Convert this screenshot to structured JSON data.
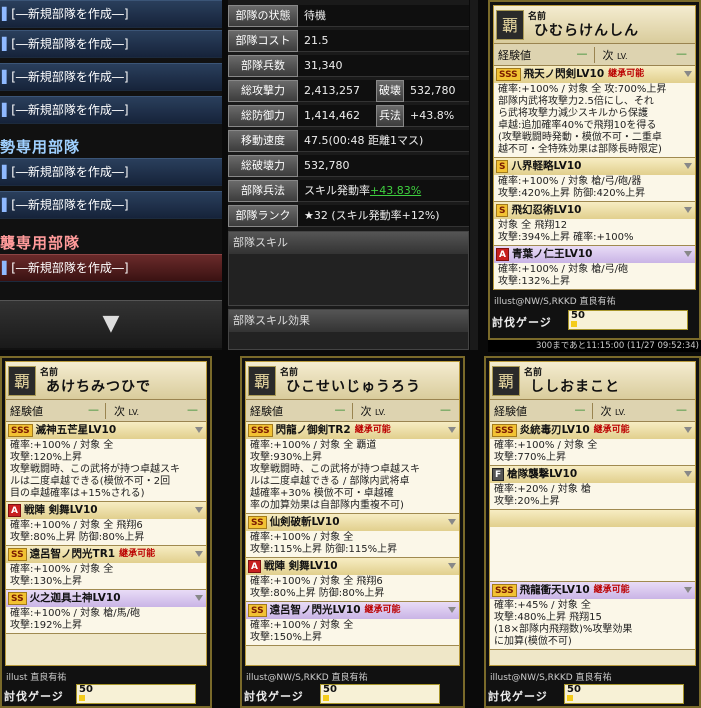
{
  "left": {
    "slots": [
      "[―新規部隊を作成―]",
      "[―新規部隊を作成―]",
      "[―新規部隊を作成―]",
      "[―新規部隊を作成―]",
      "[―新規部隊を作成―]",
      "[―新規部隊を作成―]",
      "[―新規部隊を作成―]"
    ],
    "sec1": "勢専用部隊",
    "sec2": "襲専用部隊",
    "arrow": "▼"
  },
  "stats": {
    "status_l": "部隊の状態",
    "status_v": "待機",
    "cost_l": "部隊コスト",
    "cost_v": "21.5",
    "troops_l": "部隊兵数",
    "troops_v": "31,340",
    "atk_l": "総攻撃力",
    "atk_v": "2,413,257",
    "break_l": "破壊",
    "break_v": "532,780",
    "def_l": "総防御力",
    "def_v": "1,414,462",
    "hei_l": "兵法",
    "hei_v": "+43.8%",
    "speed_l": "移動速度",
    "speed_v": "47.5(00:48 距離1マス)",
    "totbreak_l": "総破壊力",
    "totbreak_v": "532,780",
    "heiho_l": "部隊兵法",
    "heiho_v": "スキル発動率",
    "heiho_g": "+43.83%",
    "rank_l": "部隊ランク",
    "rank_v": "★32 (スキル発動率+12%)",
    "skill_h": "部隊スキル",
    "effect_h": "部隊スキル効果"
  },
  "cards": [
    {
      "label": "名前",
      "name": "ひむらけんしん",
      "exp_l": "経験値",
      "exp_v": "—",
      "next_l": "次",
      "next_lv": "LV.",
      "next_v": "—",
      "skills": [
        {
          "rank": "SSS",
          "name": "飛天ノ閃剣LV10",
          "tag": "継承可能",
          "desc": [
            "確率:+100% / 対象 全 攻:700%上昇",
            "部隊内武将攻撃力2.5倍にし、それ",
            "ら武将攻撃力減少スキルから保護",
            "卓越:追加確率40%で飛翔10を得る",
            "(攻撃戦闘時発動・模倣不可・二重卓",
            "越不可・全特殊効果は部隊長時限定)"
          ]
        },
        {
          "rank": "S",
          "name": "八界軽略LV10",
          "desc": [
            "確率:+100% / 対象 槍/弓/砲/器",
            "攻撃:420%上昇 防御:420%上昇"
          ]
        },
        {
          "rank": "S",
          "name": "飛幻忍術LV10",
          "desc": [
            "対象 全 飛翔12",
            "攻撃:394%上昇 確率:+100%"
          ]
        },
        {
          "rank": "A",
          "name": "青葉ノ仁王LV10",
          "purple": true,
          "desc": [
            "確率:+100% / 対象 槍/弓/砲",
            "攻撃:132%上昇"
          ]
        }
      ],
      "illust": "illust@NW/S,RKKD 直良有祐",
      "gauge_l": "討伐ゲージ",
      "gauge_v": "50"
    },
    {
      "label": "名前",
      "name": "あけちみつひで",
      "exp_l": "経験値",
      "exp_v": "—",
      "next_l": "次",
      "next_lv": "LV.",
      "next_v": "—",
      "skills": [
        {
          "rank": "SSS",
          "name": "滅神五芒星LV10",
          "desc": [
            "確率:+100% / 対象 全",
            "攻撃:120%上昇",
            "攻撃戦闘時、この武将が持つ卓越スキ",
            "ルは二度卓越できる(模倣不可・2回",
            "目の卓越確率は+15%される)"
          ]
        },
        {
          "rank": "A",
          "name": "戦陣 剣舞LV10",
          "desc": [
            "確率:+100% / 対象 全 飛翔6",
            "攻撃:80%上昇 防御:80%上昇"
          ]
        },
        {
          "rank": "SS",
          "name": "遠呂智ノ閃光TR1",
          "tag": "継承可能",
          "desc": [
            "確率:+100% / 対象 全",
            "攻撃:130%上昇"
          ]
        },
        {
          "rank": "SS",
          "name": "火之迦具土神LV10",
          "purple": true,
          "desc": [
            "確率:+100% / 対象 槍/馬/砲",
            "攻撃:192%上昇"
          ]
        }
      ],
      "illust": "illust 直良有祐",
      "gauge_l": "討伐ゲージ",
      "gauge_v": "50"
    },
    {
      "label": "名前",
      "name": "ひこせいじゅうろう",
      "exp_l": "経験値",
      "exp_v": "—",
      "next_l": "次",
      "next_lv": "LV.",
      "next_v": "—",
      "skills": [
        {
          "rank": "SSS",
          "name": "閃龍ノ御剣TR2",
          "tag": "継承可能",
          "desc": [
            "確率:+100% / 対象 全 覇道",
            "攻撃:930%上昇",
            "攻撃戦闘時、この武将が持つ卓越スキ",
            "ルは二度卓越できる / 部隊内武将卓",
            "越確率+30% 模倣不可・卓越確",
            "率の加算効果は自部隊内重複不可)"
          ]
        },
        {
          "rank": "SS",
          "name": "仙剣破斬LV10",
          "desc": [
            "確率:+100% / 対象 全",
            "攻撃:115%上昇 防御:115%上昇"
          ]
        },
        {
          "rank": "A",
          "name": "戦陣 剣舞LV10",
          "desc": [
            "確率:+100% / 対象 全 飛翔6",
            "攻撃:80%上昇 防御:80%上昇"
          ]
        },
        {
          "rank": "SS",
          "name": "遠呂智ノ閃光LV10",
          "tag": "継承可能",
          "purple": true,
          "desc": [
            "確率:+100% / 対象 全",
            "攻撃:150%上昇"
          ]
        }
      ],
      "illust": "illust@NW/S,RKKD 直良有祐",
      "gauge_l": "討伐ゲージ",
      "gauge_v": "50"
    },
    {
      "label": "名前",
      "name": "ししおまこと",
      "exp_l": "経験値",
      "exp_v": "—",
      "next_l": "次",
      "next_lv": "LV.",
      "next_v": "—",
      "skills": [
        {
          "rank": "SSS",
          "name": "炎統毒刃LV10",
          "tag": "継承可能",
          "desc": [
            "確率:+100% / 対象 全",
            "攻撃:770%上昇"
          ]
        },
        {
          "rank": "F",
          "name": "槍隊襲撃LV10",
          "desc": [
            "確率:+20% / 対象 槍",
            "攻撃:20%上昇"
          ]
        },
        {
          "rank": "",
          "name": "",
          "desc": [
            ""
          ]
        },
        {
          "rank": "SSS",
          "name": "飛龍衝天LV10",
          "tag": "継承可能",
          "purple": true,
          "desc": [
            "確率:+45% / 対象 全",
            "攻撃:480%上昇 飛翔15",
            "(18×部隊内飛翔数)%攻撃効果",
            "に加算(模倣不可)"
          ]
        }
      ],
      "illust": "illust@NW/S,RKKD 直良有祐",
      "gauge_l": "討伐ゲージ",
      "gauge_v": "50"
    }
  ],
  "timer": "300まであと11:15:00 (11/27 09:52:34)",
  "gauge": {
    "level": 0.05
  }
}
